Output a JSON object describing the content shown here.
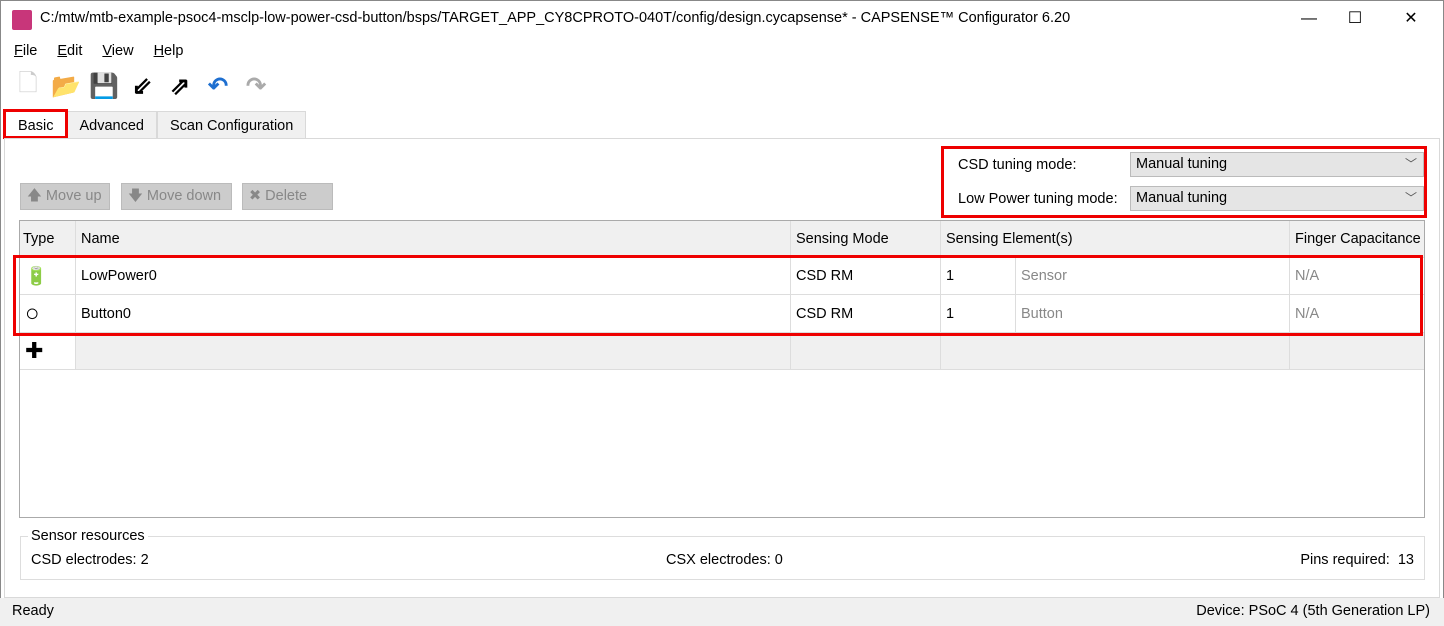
{
  "window": {
    "title": "C:/mtw/mtb-example-psoc4-msclp-low-power-csd-button/bsps/TARGET_APP_CY8CPROTO-040T/config/design.cycapsense* - CAPSENSE™ Configurator 6.20",
    "minimize": "—",
    "maximize": "☐",
    "close": "✕"
  },
  "menu": [
    "File",
    "Edit",
    "View",
    "Help"
  ],
  "toolbar": [
    {
      "name": "new-icon",
      "glyph": "🗋"
    },
    {
      "name": "open-icon",
      "glyph": "📂"
    },
    {
      "name": "save-icon",
      "glyph": "💾"
    },
    {
      "name": "import-icon",
      "glyph": "⇙"
    },
    {
      "name": "export-icon",
      "glyph": "⇗"
    },
    {
      "name": "undo-icon",
      "glyph": "↶"
    },
    {
      "name": "redo-icon",
      "glyph": "↷"
    }
  ],
  "tabs": [
    "Basic",
    "Advanced",
    "Scan Configuration"
  ],
  "actions": {
    "move_up": "🡅 Move up",
    "move_down": "🡇 Move down",
    "delete": "✖ Delete"
  },
  "tuning": {
    "csd_label": "CSD tuning mode:",
    "csd_value": "Manual tuning",
    "lp_label": "Low Power tuning mode:",
    "lp_value": "Manual tuning"
  },
  "table": {
    "headers": [
      "Type",
      "Name",
      "Sensing Mode",
      "Sensing Element(s)",
      "Finger Capacitance"
    ],
    "rows": [
      {
        "icon": "battery-icon",
        "glyph": "🔋",
        "name": "LowPower0",
        "mode": "CSD RM",
        "count": "1",
        "element": "Sensor",
        "finger": "N/A"
      },
      {
        "icon": "circle-icon",
        "glyph": "○",
        "name": "Button0",
        "mode": "CSD RM",
        "count": "1",
        "element": "Button",
        "finger": "N/A"
      }
    ],
    "add_glyph": "✚"
  },
  "resources": {
    "title": "Sensor resources",
    "csd": "CSD electrodes:  2",
    "csx": "CSX electrodes:  0",
    "pins": "Pins required:  13"
  },
  "status": {
    "left": "Ready",
    "right": "Device: PSoC 4 (5th Generation LP)"
  },
  "colors": {
    "highlight": "#e00000",
    "accent_blue": "#1e6fd0"
  }
}
